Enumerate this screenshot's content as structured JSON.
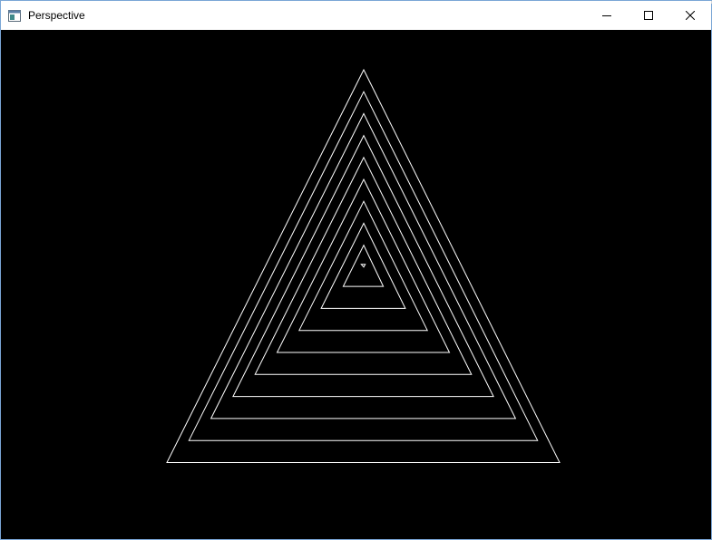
{
  "window": {
    "title": "Perspective",
    "icon": "app-window-icon",
    "controls": [
      {
        "name": "minimize-button",
        "icon": "minimize-icon"
      },
      {
        "name": "maximize-button",
        "icon": "maximize-icon"
      },
      {
        "name": "close-button",
        "icon": "close-icon"
      }
    ]
  },
  "canvas": {
    "background": "#000000",
    "stroke_color": "#ffffff",
    "shape": "nested-triangles",
    "triangle_count": 10
  }
}
